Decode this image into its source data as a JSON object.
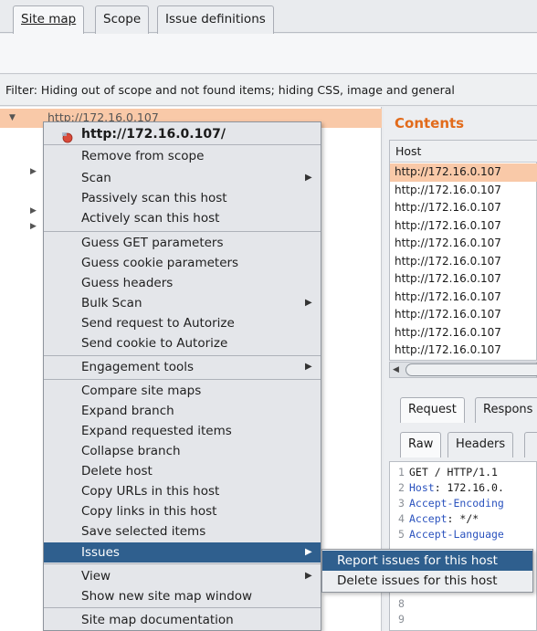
{
  "tabs": [
    "Site map",
    "Scope",
    "Issue definitions"
  ],
  "filter_text": "Filter: Hiding out of scope and not found items;  hiding CSS, image and general",
  "tree": {
    "selected_row_text": "http://172.16.0.107"
  },
  "contents": {
    "title": "Contents",
    "column_host": "Host",
    "rows": [
      "http://172.16.0.107",
      "http://172.16.0.107",
      "http://172.16.0.107",
      "http://172.16.0.107",
      "http://172.16.0.107",
      "http://172.16.0.107",
      "http://172.16.0.107",
      "http://172.16.0.107",
      "http://172.16.0.107",
      "http://172.16.0.107",
      "http://172.16.0.107"
    ]
  },
  "request_tabs": [
    "Request",
    "Respons"
  ],
  "view_tabs": [
    "Raw",
    "Headers"
  ],
  "editor_lines": [
    {
      "n": "1",
      "key": "",
      "text": "GET / HTTP/1.1"
    },
    {
      "n": "2",
      "key": "Host",
      "text": ": 172.16.0."
    },
    {
      "n": "3",
      "key": "Accept-Encoding",
      "text": ""
    },
    {
      "n": "4",
      "key": "Accept",
      "text": ": */*"
    },
    {
      "n": "5",
      "key": "Accept-Language",
      "text": ""
    },
    {
      "n": "8",
      "key": "",
      "text": ""
    },
    {
      "n": "9",
      "key": "",
      "text": ""
    }
  ],
  "menu": {
    "header": "http://172.16.0.107/",
    "items": [
      {
        "label": "Remove from scope"
      },
      {
        "label": "Scan"
      },
      {
        "label": "Passively scan this host"
      },
      {
        "label": "Actively scan this host"
      },
      {
        "label": "Guess GET parameters"
      },
      {
        "label": "Guess cookie parameters"
      },
      {
        "label": "Guess headers"
      },
      {
        "label": "Bulk Scan"
      },
      {
        "label": "Send request to Autorize"
      },
      {
        "label": "Send cookie to Autorize"
      },
      {
        "label": "Engagement tools"
      },
      {
        "label": "Compare site maps"
      },
      {
        "label": "Expand branch"
      },
      {
        "label": "Expand requested items"
      },
      {
        "label": "Collapse branch"
      },
      {
        "label": "Delete host"
      },
      {
        "label": "Copy URLs in this host"
      },
      {
        "label": "Copy links in this host"
      },
      {
        "label": "Save selected items"
      },
      {
        "label": "Issues"
      },
      {
        "label": "View"
      },
      {
        "label": "Show new site map window"
      },
      {
        "label": "Site map documentation"
      }
    ],
    "submenu_arrow": "▶"
  },
  "submenu": {
    "items": [
      {
        "label": "Report issues for this host"
      },
      {
        "label": "Delete issues for this host"
      }
    ]
  },
  "colors": {
    "accent_orange": "#e26b1b",
    "selection_peach": "#f9c9a8",
    "menu_highlight": "#2f5f8e"
  }
}
